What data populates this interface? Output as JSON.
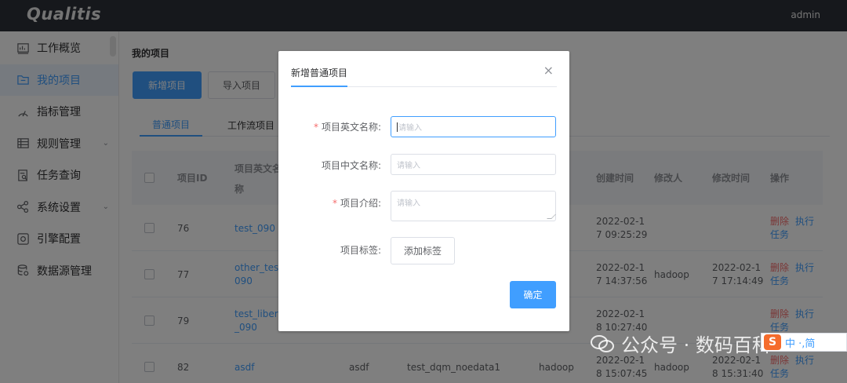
{
  "app": {
    "logo": "Qualitis",
    "user": "admin"
  },
  "sidebar": {
    "items": [
      {
        "label": "工作概览",
        "icon": "chart-icon"
      },
      {
        "label": "我的项目",
        "icon": "folder-icon"
      },
      {
        "label": "指标管理",
        "icon": "metrics-icon"
      },
      {
        "label": "规则管理",
        "icon": "rules-icon",
        "arrow": "⌄"
      },
      {
        "label": "任务查询",
        "icon": "task-search-icon"
      },
      {
        "label": "系统设置",
        "icon": "settings-icon",
        "arrow": "⌄"
      },
      {
        "label": "引擎配置",
        "icon": "engine-icon"
      },
      {
        "label": "数据源管理",
        "icon": "datasource-icon"
      }
    ]
  },
  "main": {
    "breadcrumb": "我的项目",
    "buttons": {
      "new_project": "新增项目",
      "import_project": "导入项目"
    },
    "tabs": [
      "普通项目",
      "工作流项目"
    ],
    "table": {
      "headers": {
        "id": "项目ID",
        "name_en": "项目英文名",
        "name_en_2": "称",
        "created_at": "创建时间",
        "modifier": "修改人",
        "modified_at": "修改时间",
        "ops": "操作"
      },
      "rows": [
        {
          "id": "76",
          "name_l1": "test_090",
          "name_l2": "",
          "c3": "",
          "c4": "",
          "c5": "",
          "created_l1": "2022-02-1",
          "created_l2": "7 09:25:29",
          "modifier": "",
          "modified_l1": "",
          "modified_l2": ""
        },
        {
          "id": "77",
          "name_l1": "other_test",
          "name_l2": "090",
          "c3": "",
          "c4": "",
          "c5": "",
          "created_l1": "2022-02-1",
          "created_l2": "7 14:37:56",
          "modifier": "hadoop",
          "modified_l1": "2022-02-1",
          "modified_l2": "7 17:14:49"
        },
        {
          "id": "79",
          "name_l1": "test_libery",
          "name_l2": "_090",
          "c3": "",
          "c4": "",
          "c5": "",
          "created_l1": "2022-02-1",
          "created_l2": "8 10:27:40",
          "modifier": "",
          "modified_l1": "",
          "modified_l2": ""
        },
        {
          "id": "82",
          "name_l1": "asdf",
          "name_l2": "",
          "c3": "asdf",
          "c4": "test_dqm_noedata1",
          "c5": "hadoop",
          "created_l1": "2022-02-1",
          "created_l2": "8 15:07:45",
          "modifier": "hadoop",
          "modified_l1": "2022-02-1",
          "modified_l2": "8 15:31:40"
        }
      ],
      "ops": {
        "delete": "删除",
        "execute": "执行",
        "task": "任务"
      }
    }
  },
  "dialog": {
    "title": "新增普通项目",
    "close": "×",
    "fields": {
      "name_en_label": "项目英文名称:",
      "name_cn_label": "项目中文名称:",
      "intro_label": "项目介绍:",
      "tags_label": "项目标签:",
      "placeholder": "请输入"
    },
    "add_tag": "添加标签",
    "confirm": "确定"
  },
  "watermark": "公众号 · 数码百科",
  "ime": {
    "logo": "S",
    "text": "中 ·,简"
  }
}
